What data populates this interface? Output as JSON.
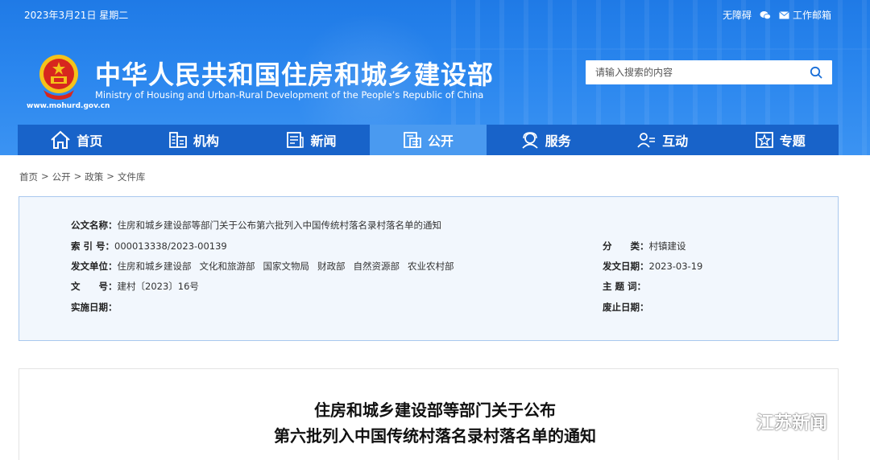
{
  "header": {
    "date": "2023年3月21日 星期二",
    "toplinks": {
      "accessibility": "无障碍",
      "mail": "工作邮箱"
    },
    "title": "中华人民共和国住房和城乡建设部",
    "subtitle": "Ministry of Housing and Urban-Rural Development of the People’s Republic of China",
    "url": "www.mohurd.gov.cn",
    "search_placeholder": "请输入搜索的内容"
  },
  "nav": {
    "items": [
      {
        "label": "首页",
        "icon": "home-icon"
      },
      {
        "label": "机构",
        "icon": "org-icon"
      },
      {
        "label": "新闻",
        "icon": "news-icon"
      },
      {
        "label": "公开",
        "icon": "public-icon"
      },
      {
        "label": "服务",
        "icon": "service-icon"
      },
      {
        "label": "互动",
        "icon": "interact-icon"
      },
      {
        "label": "专题",
        "icon": "topic-icon"
      }
    ],
    "active": "公开"
  },
  "breadcrumb": [
    "首页",
    "公开",
    "政策",
    "文件库"
  ],
  "breadcrumb_sep": ">",
  "meta": {
    "doc_name_label": "公文名称：",
    "doc_name": "住房和城乡建设部等部门关于公布第六批列入中国传统村落名录村落名单的通知",
    "index_label": "索 引 号：",
    "index": "000013338/2023-00139",
    "category_label": "分　　类：",
    "category": "村镇建设",
    "issuer_label": "发文单位：",
    "issuers": [
      "住房和城乡建设部",
      "文化和旅游部",
      "国家文物局",
      "财政部",
      "自然资源部",
      "农业农村部"
    ],
    "issue_date_label": "发文日期：",
    "issue_date": "2023-03-19",
    "doc_no_label": "文　　号：",
    "doc_no": "建村〔2023〕16号",
    "keywords_label": "主 题 词：",
    "effective_label": "实施日期：",
    "abolish_label": "废止日期："
  },
  "document": {
    "title_line1": "住房和城乡建设部等部门关于公布",
    "title_line2": "第六批列入中国传统村落名录村落名单的通知"
  },
  "watermark": {
    "text": "江苏新闻"
  },
  "colors": {
    "header_blue": "#2a86ee",
    "nav_blue": "#1863c9",
    "nav_active": "#4a9af0",
    "meta_bg": "#f2f7fd",
    "meta_border": "#a9c8ee"
  }
}
